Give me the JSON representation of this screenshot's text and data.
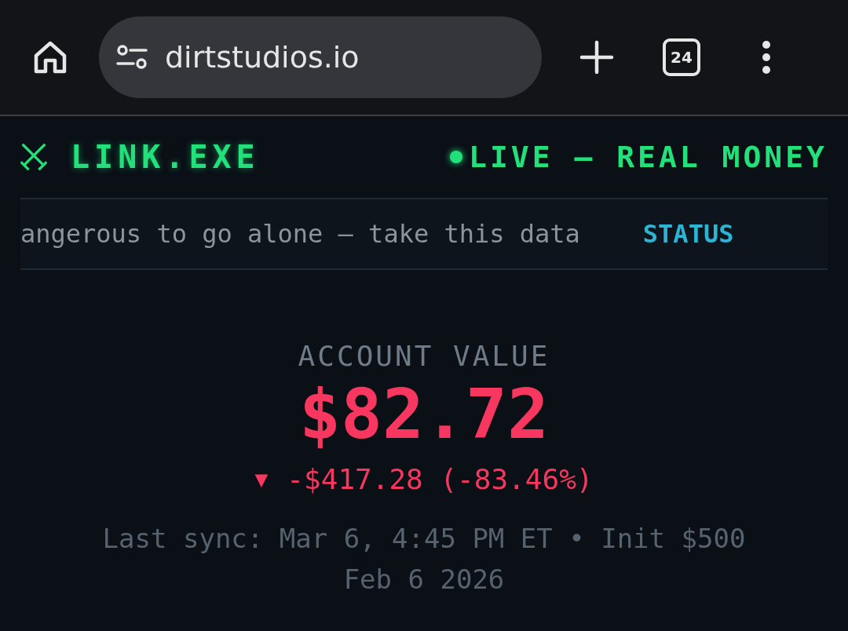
{
  "browser": {
    "url": "dirtstudios.io",
    "tab_count": "24"
  },
  "header": {
    "logo": "LINK.EXE",
    "status": {
      "label": "LIVE — REAL MONEY",
      "live": true
    }
  },
  "ticker": [
    {
      "kind": "text",
      "text": "angerous to go alone — take this data"
    },
    {
      "kind": "tag",
      "text": "STATUS"
    }
  ],
  "account": {
    "label": "ACCOUNT VALUE",
    "value": "$82.72",
    "loss": true,
    "trend_icon": "▼",
    "change": "-$417.28 (-83.46%)",
    "sync": "Last sync: Mar 6, 4:45 PM ET • Init $500",
    "date": "Feb 6 2026"
  }
}
